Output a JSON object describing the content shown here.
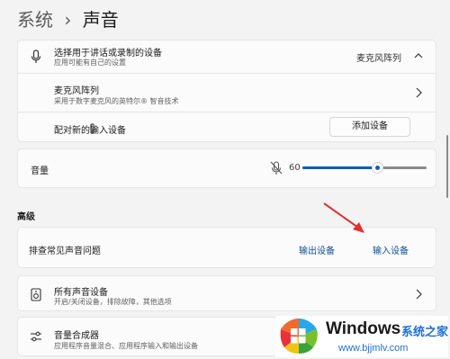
{
  "breadcrumb": {
    "parent": "系统",
    "separator": "›",
    "current": "声音"
  },
  "input_select": {
    "title": "选择用于讲话或录制的设备",
    "subtitle": "应用可能有自己的设置",
    "value": "麦克风阵列"
  },
  "mic_device": {
    "name": "麦克风阵列",
    "description": "采用于数字麦克风的英特尔® 智音技术"
  },
  "pair_new": {
    "label": "配对新的输入设备",
    "button": "添加设备"
  },
  "volume": {
    "label": "音量",
    "value": "60",
    "level": 0.6
  },
  "advanced": {
    "heading": "高级",
    "troubleshoot": {
      "label": "排查常见声音问题",
      "output_link": "输出设备",
      "input_link": "输入设备"
    },
    "all_devices": {
      "title": "所有声音设备",
      "subtitle": "开启/关闭设备，排除故障，其他选项"
    },
    "mixer": {
      "title": "音量合成器",
      "subtitle": "应用程序音量混合、应用程序输入和输出设备"
    }
  },
  "watermark": {
    "brand": "Windows",
    "cn": "系统之家",
    "url": "www.bjjmlv.com"
  },
  "colors": {
    "accent": "#0f5fb5",
    "arrow": "#e03030"
  }
}
